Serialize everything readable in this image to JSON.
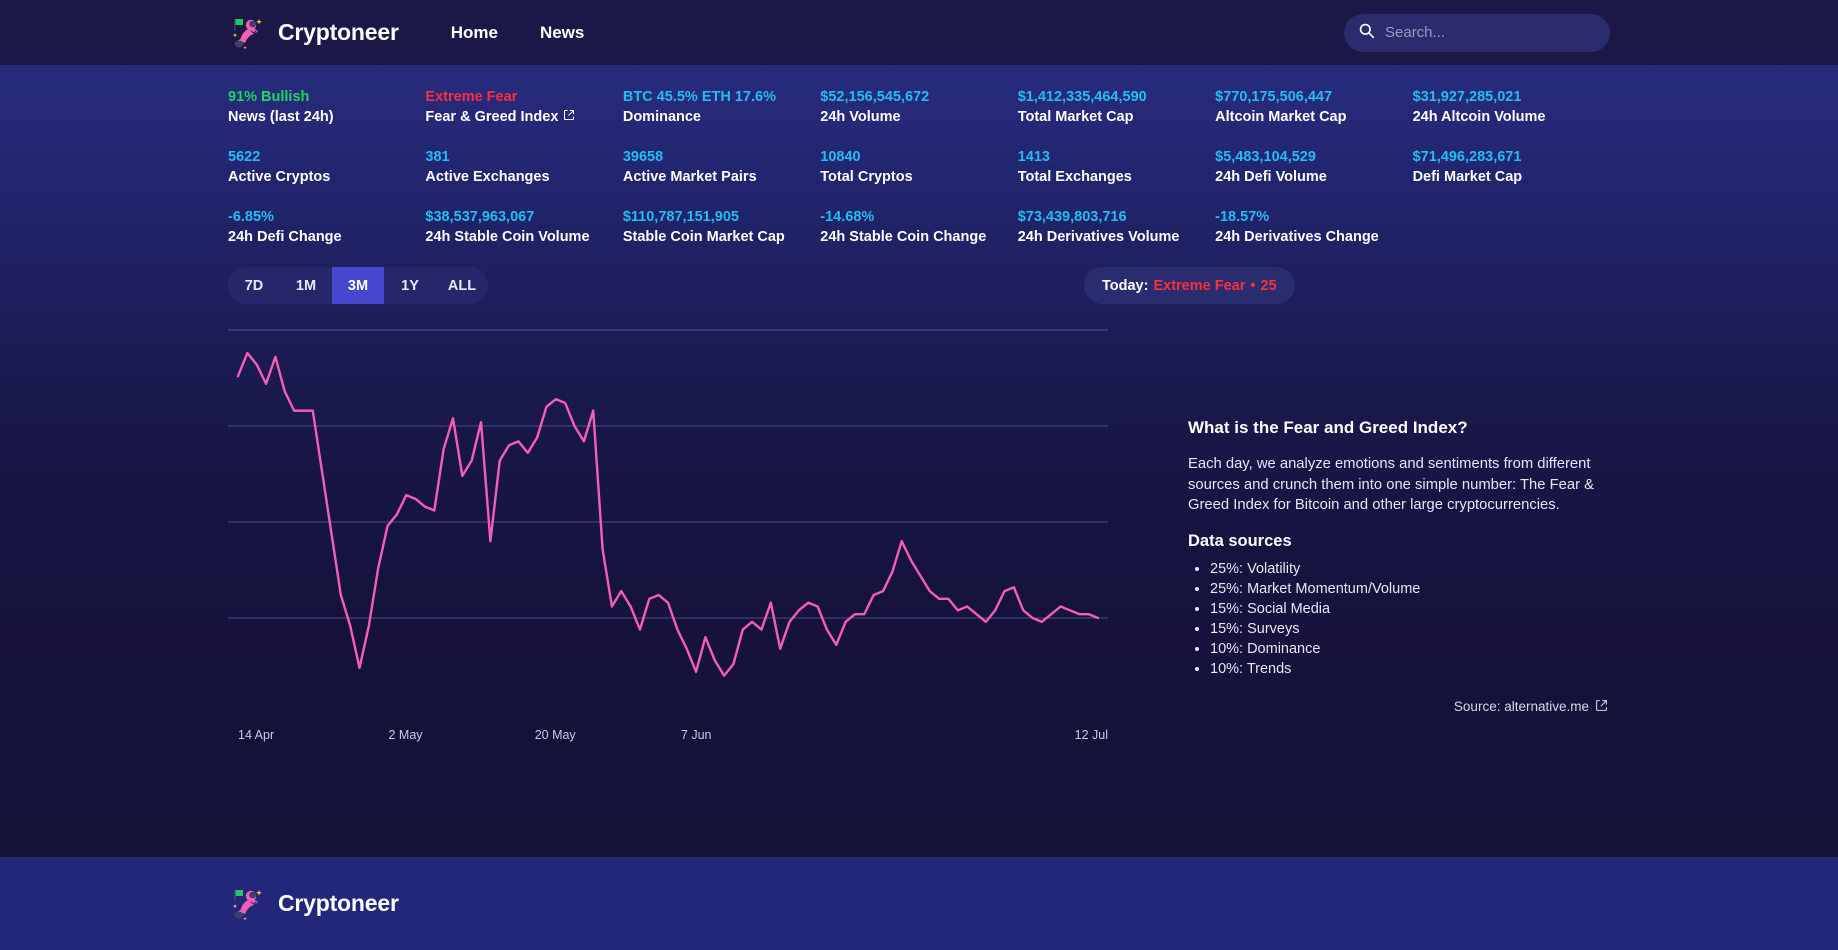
{
  "brand": {
    "name": "Cryptoneer",
    "logo_icon": "astronaut-logo-icon"
  },
  "nav": {
    "links": [
      {
        "label": "Home",
        "name": "nav-link-home"
      },
      {
        "label": "News",
        "name": "nav-link-news"
      }
    ]
  },
  "search": {
    "placeholder": "Search...",
    "value": "",
    "icon": "search-icon"
  },
  "colors": {
    "green": "#1ed760",
    "red": "#ff2d3f",
    "cyan": "#24bdf0",
    "accent_pink": "#f05fb8",
    "active_pill": "#4548cf"
  },
  "stats": {
    "rows": [
      [
        {
          "value": "91% Bullish",
          "label": "News (last 24h)",
          "color": "green",
          "external": false
        },
        {
          "value": "Extreme Fear",
          "label": "Fear & Greed Index",
          "color": "red",
          "external": true
        },
        {
          "value": "BTC 45.5% ETH 17.6%",
          "label": "Dominance",
          "color": "cyan",
          "external": false
        },
        {
          "value": "$52,156,545,672",
          "label": "24h Volume",
          "color": "cyan",
          "external": false
        },
        {
          "value": "$1,412,335,464,590",
          "label": "Total Market Cap",
          "color": "cyan",
          "external": false
        },
        {
          "value": "$770,175,506,447",
          "label": "Altcoin Market Cap",
          "color": "cyan",
          "external": false
        },
        {
          "value": "$31,927,285,021",
          "label": "24h Altcoin Volume",
          "color": "cyan",
          "external": false
        }
      ],
      [
        {
          "value": "5622",
          "label": "Active Cryptos",
          "color": "cyan",
          "external": false
        },
        {
          "value": "381",
          "label": "Active Exchanges",
          "color": "cyan",
          "external": false
        },
        {
          "value": "39658",
          "label": "Active Market Pairs",
          "color": "cyan",
          "external": false
        },
        {
          "value": "10840",
          "label": "Total Cryptos",
          "color": "cyan",
          "external": false
        },
        {
          "value": "1413",
          "label": "Total Exchanges",
          "color": "cyan",
          "external": false
        },
        {
          "value": "$5,483,104,529",
          "label": "24h Defi Volume",
          "color": "cyan",
          "external": false
        },
        {
          "value": "$71,496,283,671",
          "label": "Defi Market Cap",
          "color": "cyan",
          "external": false
        }
      ],
      [
        {
          "value": "-6.85%",
          "label": "24h Defi Change",
          "color": "cyan",
          "external": false
        },
        {
          "value": "$38,537,963,067",
          "label": "24h Stable Coin Volume",
          "color": "cyan",
          "external": false
        },
        {
          "value": "$110,787,151,905",
          "label": "Stable Coin Market Cap",
          "color": "cyan",
          "external": false
        },
        {
          "value": "-14.68%",
          "label": "24h Stable Coin Change",
          "color": "cyan",
          "external": false
        },
        {
          "value": "$73,439,803,716",
          "label": "24h Derivatives Volume",
          "color": "cyan",
          "external": false
        },
        {
          "value": "-18.57%",
          "label": "24h Derivatives Change",
          "color": "cyan",
          "external": false
        },
        {
          "value": "",
          "label": "",
          "color": "cyan",
          "external": false
        }
      ]
    ]
  },
  "controls": {
    "ranges": [
      {
        "label": "7D",
        "active": false
      },
      {
        "label": "1M",
        "active": false
      },
      {
        "label": "3M",
        "active": true
      },
      {
        "label": "1Y",
        "active": false
      },
      {
        "label": "ALL",
        "active": false
      }
    ],
    "today": {
      "prefix": "Today:",
      "state": "Extreme Fear",
      "separator": "•",
      "value": "25"
    }
  },
  "info": {
    "title": "What is the Fear and Greed Index?",
    "paragraph": "Each day, we analyze emotions and sentiments from different sources and crunch them into one simple number: The Fear & Greed Index for Bitcoin and other large cryptocurrencies.",
    "subtitle": "Data sources",
    "sources": [
      "25%: Volatility",
      "25%: Market Momentum/Volume",
      "15%: Social Media",
      "15%: Surveys",
      "10%: Dominance",
      "10%: Trends"
    ],
    "source_label": "Source: alternative.me",
    "source_icon": "external-link-icon"
  },
  "footer": {
    "brand": "Cryptoneer"
  },
  "chart_data": {
    "type": "line",
    "title": "",
    "xlabel": "",
    "ylabel": "",
    "line_color": "#f45fb5",
    "grid": true,
    "gridlines_y": [
      75,
      50,
      25
    ],
    "ylim": [
      0,
      100
    ],
    "tick_labels": [
      "14 Apr",
      "2 May",
      "20 May",
      "7 Jun",
      "12 Jul"
    ],
    "tick_positions": [
      0,
      0.175,
      0.345,
      0.515,
      0.99
    ],
    "values": [
      88,
      94,
      91,
      86,
      93,
      84,
      79,
      79,
      79,
      63,
      47,
      31,
      23,
      12,
      23,
      38,
      49,
      52,
      57,
      56,
      54,
      53,
      69,
      77,
      62,
      66,
      76,
      45,
      66,
      70,
      71,
      68,
      72,
      80,
      82,
      81,
      75,
      71,
      79,
      43,
      28,
      32,
      28,
      22,
      30,
      31,
      29,
      22,
      17,
      11,
      20,
      14,
      10,
      13,
      22,
      24,
      22,
      29,
      17,
      24,
      27,
      29,
      28,
      22,
      18,
      24,
      26,
      26,
      31,
      32,
      37,
      45,
      40,
      36,
      32,
      30,
      30,
      27,
      28,
      26,
      24,
      27,
      32,
      33,
      27,
      25,
      24,
      26,
      28,
      27,
      26,
      26,
      25
    ]
  }
}
